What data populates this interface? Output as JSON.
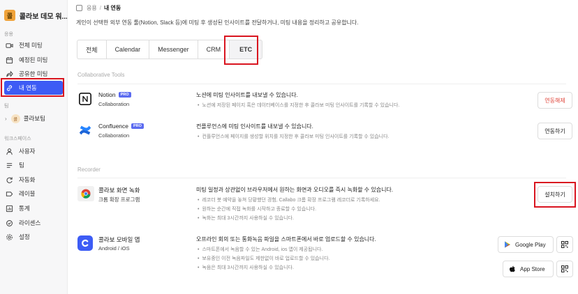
{
  "workspace": {
    "logo_char": "콜",
    "name": "콜라보 데모 워..."
  },
  "sidebar": {
    "app_section_label": "응용",
    "app_items": [
      {
        "label": "전체 미팅",
        "icon": "video-icon"
      },
      {
        "label": "예정된 미팅",
        "icon": "calendar-icon"
      },
      {
        "label": "공유한 미팅",
        "icon": "share-icon"
      },
      {
        "label": "내 연동",
        "icon": "link-icon",
        "active": true
      }
    ],
    "team_section_label": "팀",
    "team_item": {
      "avatar": "콜",
      "label": "콜라보팀"
    },
    "workspace_section_label": "워크스페이스",
    "workspace_items": [
      {
        "label": "사용자",
        "icon": "user-icon"
      },
      {
        "label": "팀",
        "icon": "list-icon"
      },
      {
        "label": "자동화",
        "icon": "automation-icon"
      },
      {
        "label": "레이블",
        "icon": "label-icon"
      },
      {
        "label": "통계",
        "icon": "chart-icon"
      },
      {
        "label": "라이센스",
        "icon": "license-icon"
      },
      {
        "label": "설정",
        "icon": "gear-icon"
      }
    ]
  },
  "breadcrumb": {
    "parent": "응용",
    "separator": "/",
    "current": "내 연동"
  },
  "description": "게인이 선택한 외부 연동 툴(Notion, Slack 등)에 미팅 후 생성된 인사이트를 전달하거나, 미팅 내용을 정리하고 공유합니다.",
  "tabs": [
    "전체",
    "Calendar",
    "Messenger",
    "CRM",
    "ETC"
  ],
  "selected_tab": "ETC",
  "groups": {
    "collab_title": "Collaborative Tools",
    "recorder_title": "Recorder"
  },
  "integrations": {
    "notion": {
      "name": "Notion",
      "badge": "PRO",
      "sub": "Collaboration",
      "desc": "노션에 미팅 인사이트를 내보낼 수 있습니다.",
      "bullets": [
        "노션에 저장된 페이지 혹은 데이터베이스를 지정한 후 콜라보 미팅 인사이트를 기록할 수 있습니다."
      ],
      "button": "연동해제"
    },
    "confluence": {
      "name": "Confluence",
      "badge": "PRO",
      "sub": "Collaboration",
      "desc": "컨플루언스에 미팅 인사이트를 내보낼 수 있습니다.",
      "bullets": [
        "컨플루언스에 페이지를 생성할 위치를 지정한 후 콜라보 미팅 인사이트를 기록할 수 있습니다."
      ],
      "button": "연동하기"
    },
    "chrome": {
      "name": "콜라보 화면 녹화",
      "sub": "크롬 확장 프로그램",
      "desc": "미팅 일정과 상관없이 브라우저에서 원하는 화면과 오디오를 즉시 녹화할 수 있습니다.",
      "bullets": [
        "레코더 봇 예약을 놓쳐 당황했던 경험, Callabo 크롬 확장 프로그램 레코더로 기록하세요.",
        "원하는 순간에 직접 녹화를 시작하고 종료할 수 있습니다.",
        "녹화는 최대 3시간까지 사용하실 수 있습니다."
      ],
      "button": "설치하기"
    },
    "mobile": {
      "name": "콜라보 모바일 앱",
      "sub": "Android / iOS",
      "desc": "오프라인 회의 또는 통화녹음 파일을 스마트폰에서 바로 업로드할 수 있습니다.",
      "bullets": [
        "스마트폰에서 녹음할 수 있는 Android, ios 앱이 제공됩니다.",
        "보유중인 이전 녹음파일도 제한없이 바로 업로드할 수 있습니다.",
        "녹음은 최대 3시간까지 사용하실 수 있습니다."
      ],
      "google_play": "Google Play",
      "app_store": "App Store"
    }
  },
  "colors": {
    "accent": "#3d5cf5",
    "highlight": "#d9141f",
    "danger": "#e0483e",
    "badge": "#5b6bf0"
  }
}
